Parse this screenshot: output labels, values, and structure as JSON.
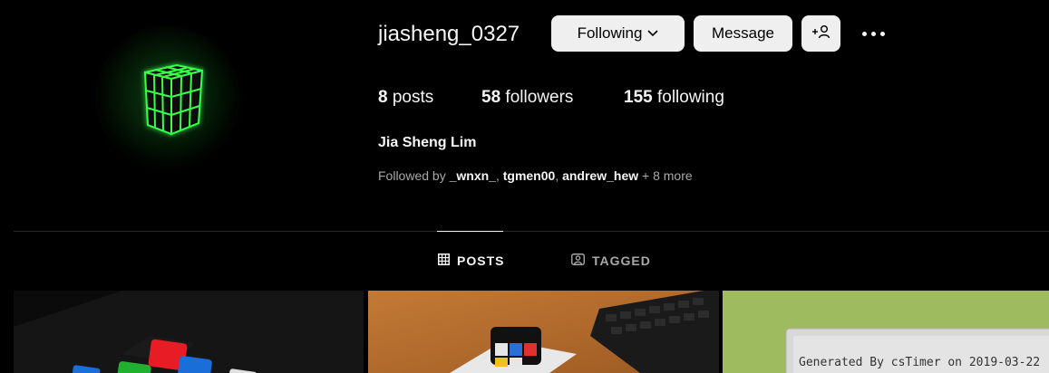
{
  "profile": {
    "username": "jiasheng_0327",
    "full_name": "Jia Sheng Lim",
    "avatar_icon": "glowing-cube-avatar"
  },
  "actions": {
    "following_label": "Following",
    "message_label": "Message",
    "add_user_icon": "add-user-icon",
    "more_icon": "more-options-icon"
  },
  "stats": {
    "posts_count": "8",
    "posts_label": "posts",
    "followers_count": "58",
    "followers_label": "followers",
    "following_count": "155",
    "following_label": "following"
  },
  "followed_by": {
    "prefix": "Followed by",
    "accounts": [
      "_wnxn_",
      "tgmen00",
      "andrew_hew"
    ],
    "more": "+ 8 more"
  },
  "tabs": [
    {
      "label": "POSTS",
      "icon": "grid-icon",
      "active": true
    },
    {
      "label": "TAGGED",
      "icon": "tagged-icon",
      "active": false
    }
  ],
  "posts": [
    {
      "icon": "rubiks-cube-photo"
    },
    {
      "icon": "desk-keyboard-cube-photo"
    },
    {
      "icon": "cstimer-printout-photo",
      "visible_text": "Generated By csTimer on 2019-03-22"
    }
  ],
  "colors": {
    "background": "#000000",
    "button": "#efefef",
    "muted_text": "#a8a8a8",
    "divider": "#262626",
    "glow_green": "#39ff4a"
  }
}
